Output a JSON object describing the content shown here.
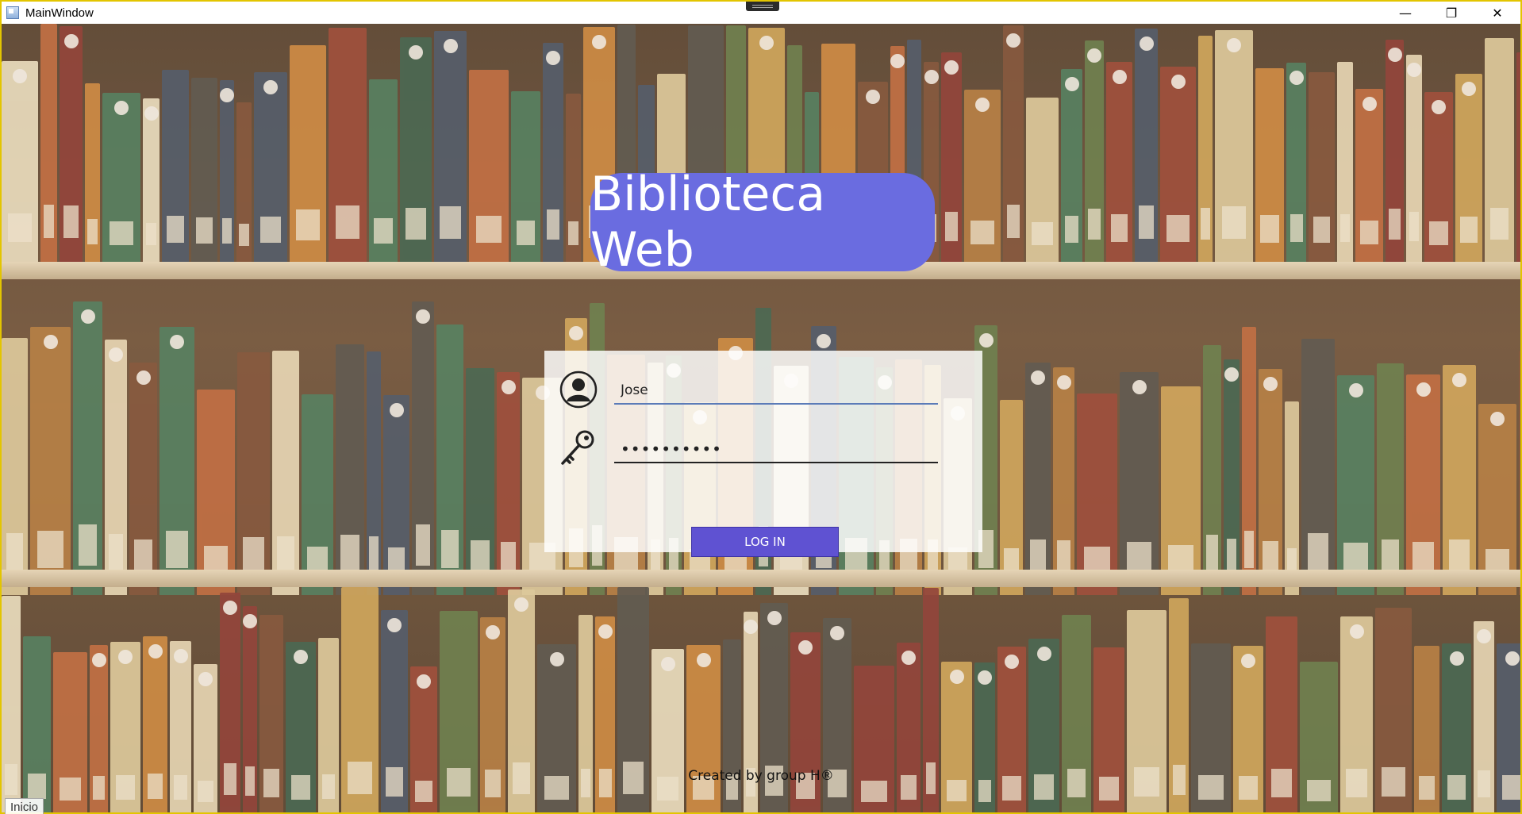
{
  "window": {
    "title": "MainWindow",
    "controls": {
      "minimize": "—",
      "restore": "❐",
      "close": "✕"
    },
    "border_color": "#e3c500"
  },
  "header": {
    "title": "Biblioteca Web",
    "color": "#6a6ce0"
  },
  "login": {
    "username_value": "Jose",
    "password_value": "••••••••••",
    "button_label": "LOG IN",
    "button_color": "#5f52d2",
    "user_icon": "user-circle-icon",
    "password_icon": "key-icon"
  },
  "footer": {
    "credit": "Created by group H®"
  },
  "status": {
    "page_label": "Inicio"
  },
  "background": {
    "image": "bookshelf"
  }
}
